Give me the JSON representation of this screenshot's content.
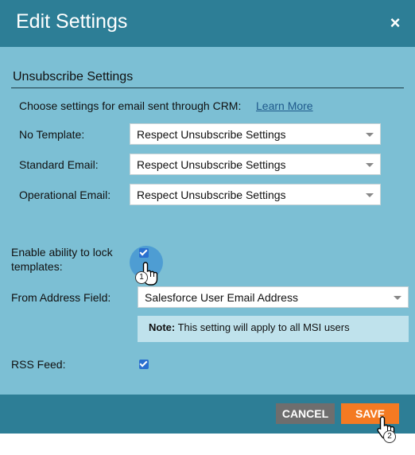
{
  "dialog": {
    "title": "Edit Settings",
    "close_icon": "×"
  },
  "unsubscribe": {
    "section_title": "Unsubscribe Settings",
    "intro": "Choose settings for email sent through CRM:",
    "learn_more": "Learn More",
    "rows": [
      {
        "label": "No Template:",
        "value": "Respect Unsubscribe Settings"
      },
      {
        "label": "Standard Email:",
        "value": "Respect Unsubscribe Settings"
      },
      {
        "label": "Operational Email:",
        "value": "Respect Unsubscribe Settings"
      }
    ]
  },
  "lock_templates": {
    "label_line1": "Enable ability to lock",
    "label_line2": "templates:",
    "checked": true
  },
  "from_address": {
    "label": "From Address Field:",
    "value": "Salesforce User Email Address"
  },
  "note": {
    "prefix": "Note:",
    "text": " This setting will apply to all MSI users"
  },
  "rss": {
    "label": "RSS Feed:",
    "checked": true
  },
  "footer": {
    "cancel": "CANCEL",
    "save": "SAVE"
  },
  "callouts": {
    "step1": "1",
    "step2": "2"
  },
  "colors": {
    "header": "#2d7e96",
    "body": "#7cbfd4",
    "save": "#f47a22",
    "cancel": "#6e6e6e",
    "checkbox": "#2a6fcf"
  }
}
